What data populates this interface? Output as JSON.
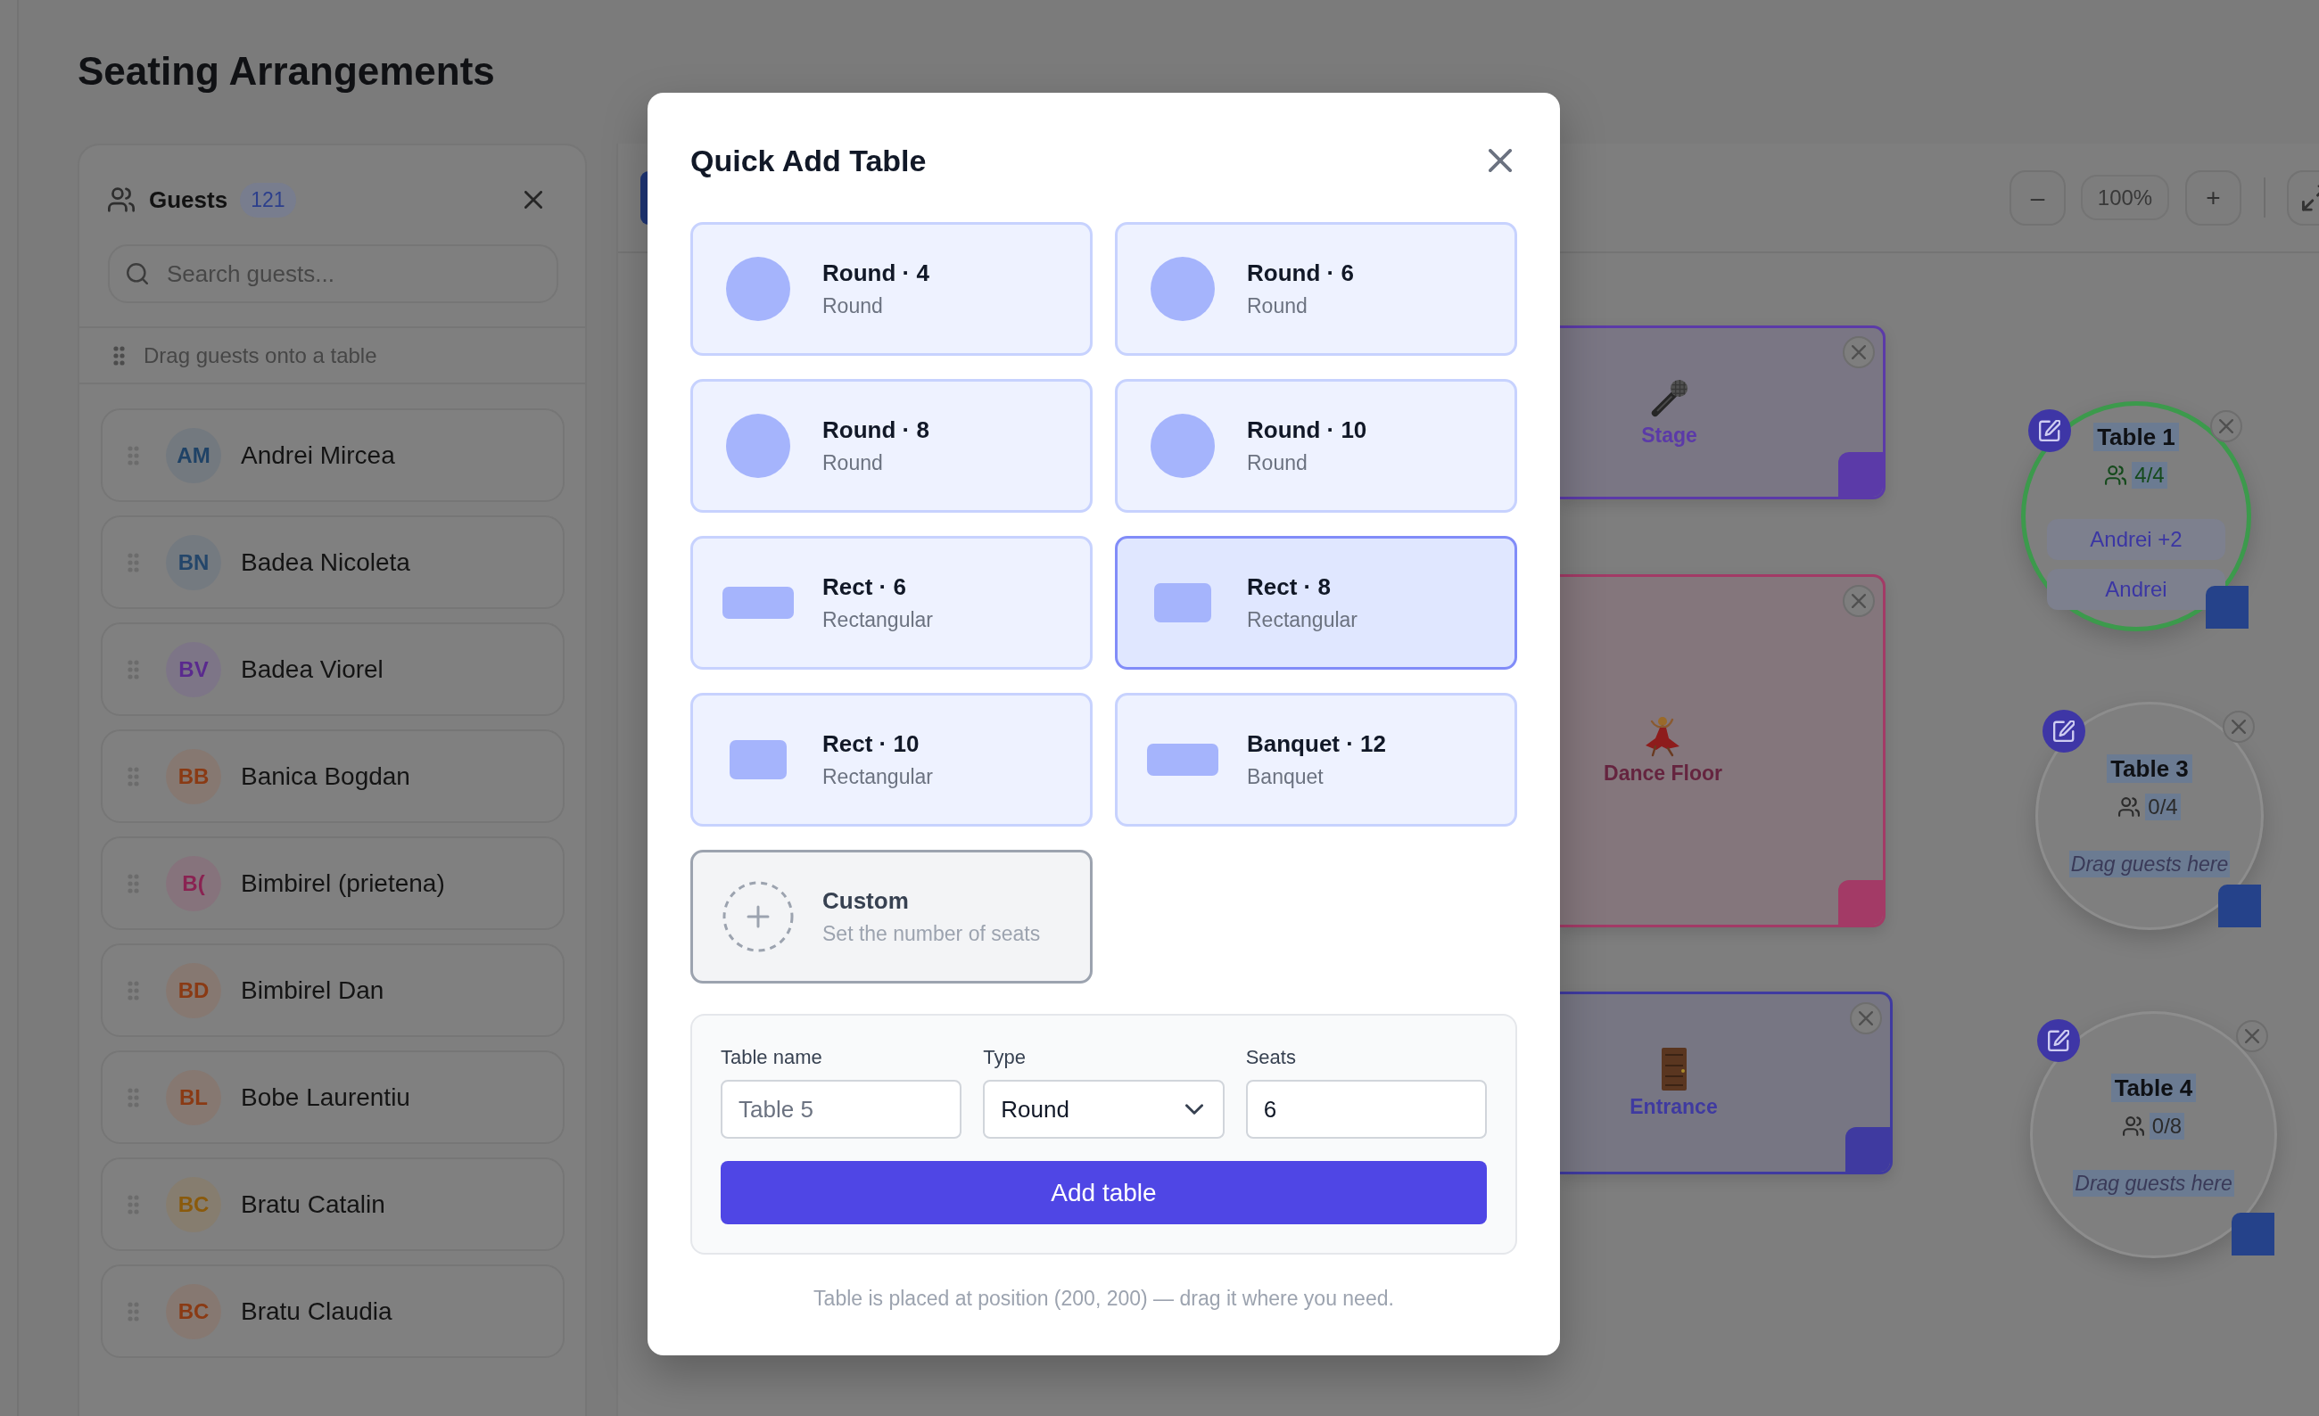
{
  "page": {
    "title": "Seating Arrangements"
  },
  "guest_panel": {
    "title": "Guests",
    "count": "121",
    "search": {
      "placeholder": "Search guests..."
    },
    "hint": "Drag guests onto a table",
    "guests": [
      {
        "initials": "AM",
        "name": "Andrei Mircea",
        "color": "#1f4266"
      },
      {
        "initials": "BN",
        "name": "Badea Nicoleta",
        "color": "#24466a"
      },
      {
        "initials": "BV",
        "name": "Badea Viorel",
        "color": "#5a2a8e"
      },
      {
        "initials": "BB",
        "name": "Banica Bogdan",
        "color": "#8a3a14"
      },
      {
        "initials": "B(",
        "name": "Bimbirel (prietena)",
        "color": "#8a2352"
      },
      {
        "initials": "BD",
        "name": "Bimbirel Dan",
        "color": "#8a3a14"
      },
      {
        "initials": "BL",
        "name": "Bobe Laurentiu",
        "color": "#8a3a14"
      },
      {
        "initials": "BC",
        "name": "Bratu Catalin",
        "color": "#8a5a0c"
      },
      {
        "initials": "BC",
        "name": "Bratu Claudia",
        "color": "#8a3a14"
      }
    ]
  },
  "canvas": {
    "toolbar": {
      "zoom_out": "–",
      "zoom_level": "100%",
      "zoom_in": "+"
    },
    "zones": [
      {
        "kind": "stage",
        "label": "Stage",
        "color": "#5b3aa8"
      },
      {
        "kind": "dancefloor",
        "label": "Dance Floor",
        "color": "#a33a66"
      },
      {
        "kind": "entrance",
        "label": "Entrance",
        "color": "#3f3aa0"
      }
    ],
    "tables": [
      {
        "name": "Table 1",
        "seated": "4/4",
        "full": true,
        "guests": [
          "Andrei +2",
          "Andrei"
        ]
      },
      {
        "name": "Table 3",
        "seated": "0/4",
        "full": false,
        "hint": "Drag guests here"
      },
      {
        "name": "Table 4",
        "seated": "0/8",
        "full": false,
        "hint": "Drag guests here"
      }
    ]
  },
  "dialog": {
    "title": "Quick Add Table",
    "presets": [
      {
        "kind": "round",
        "title": "Round · 4",
        "subtitle": "Round",
        "selected": false
      },
      {
        "kind": "round",
        "title": "Round · 6",
        "subtitle": "Round",
        "selected": false
      },
      {
        "kind": "round",
        "title": "Round · 8",
        "subtitle": "Round",
        "selected": false
      },
      {
        "kind": "round",
        "title": "Round · 10",
        "subtitle": "Round",
        "selected": false
      },
      {
        "kind": "oblong",
        "title": "Rect · 6",
        "subtitle": "Rectangular",
        "selected": false
      },
      {
        "kind": "rect",
        "title": "Rect · 8",
        "subtitle": "Rectangular",
        "selected": true
      },
      {
        "kind": "rect",
        "title": "Rect · 10",
        "subtitle": "Rectangular",
        "selected": false
      },
      {
        "kind": "oblong",
        "title": "Banquet · 12",
        "subtitle": "Banquet",
        "selected": false
      },
      {
        "kind": "custom",
        "title": "Custom",
        "subtitle": "Set the number of seats",
        "selected": false
      }
    ],
    "form": {
      "fields": [
        {
          "kind": "text",
          "label": "Table name",
          "placeholder": "Table 5"
        },
        {
          "kind": "select",
          "label": "Type",
          "value": "Round"
        },
        {
          "kind": "number",
          "label": "Seats",
          "value": "6"
        }
      ],
      "submit": "Add table"
    },
    "note": "Table is placed at position (200, 200) — drag it where you need."
  }
}
